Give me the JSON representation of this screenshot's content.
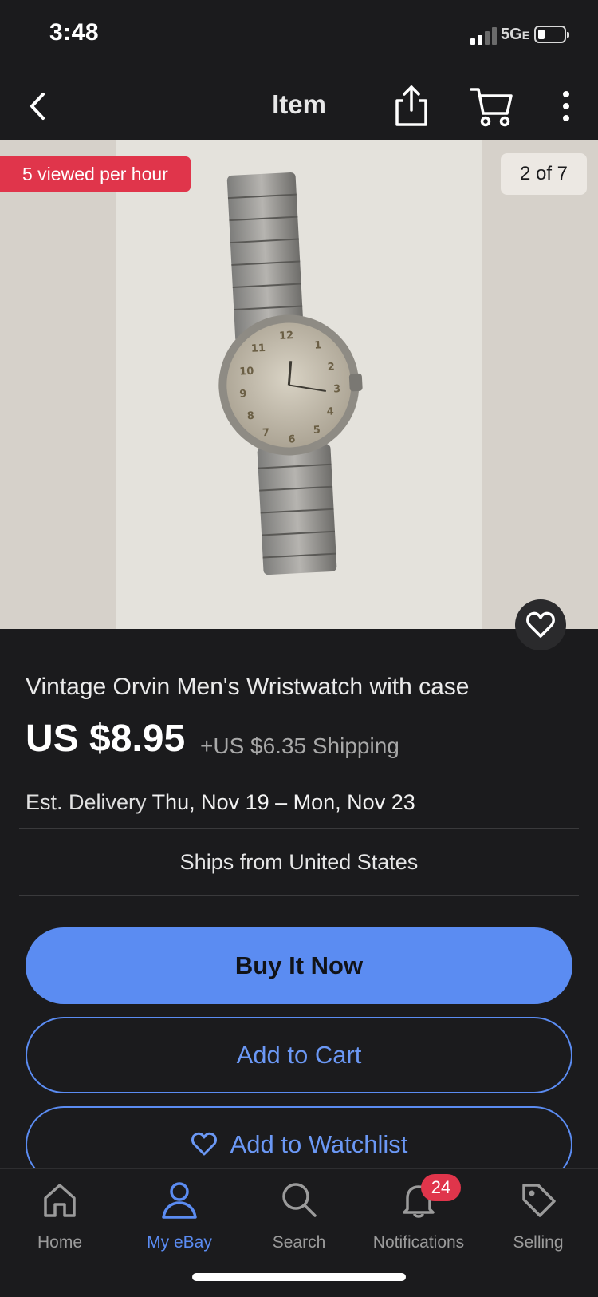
{
  "status_bar": {
    "time": "3:48",
    "network": "5G",
    "network_suffix": "E"
  },
  "nav": {
    "title": "Item"
  },
  "gallery": {
    "viewed_badge": "5 viewed per hour",
    "counter": "2 of 7"
  },
  "item": {
    "title": "Vintage Orvin Men's Wristwatch with case",
    "price": "US $8.95",
    "shipping": "+US $6.35 Shipping",
    "delivery_label": "Est. Delivery",
    "delivery_dates": "Thu, Nov 19 – Mon, Nov 23",
    "ships_from": "Ships from United States"
  },
  "actions": {
    "buy_now": "Buy It Now",
    "add_to_cart": "Add to Cart",
    "add_to_watchlist": "Add to Watchlist"
  },
  "tab_bar": {
    "items": [
      {
        "label": "Home",
        "icon": "home-icon"
      },
      {
        "label": "My eBay",
        "icon": "person-icon"
      },
      {
        "label": "Search",
        "icon": "search-icon"
      },
      {
        "label": "Notifications",
        "icon": "bell-icon",
        "badge": "24"
      },
      {
        "label": "Selling",
        "icon": "tag-icon"
      }
    ],
    "active": "My eBay"
  },
  "colors": {
    "accent": "#5b8cf2",
    "badge_red": "#e0354b",
    "background": "#1b1b1d"
  }
}
